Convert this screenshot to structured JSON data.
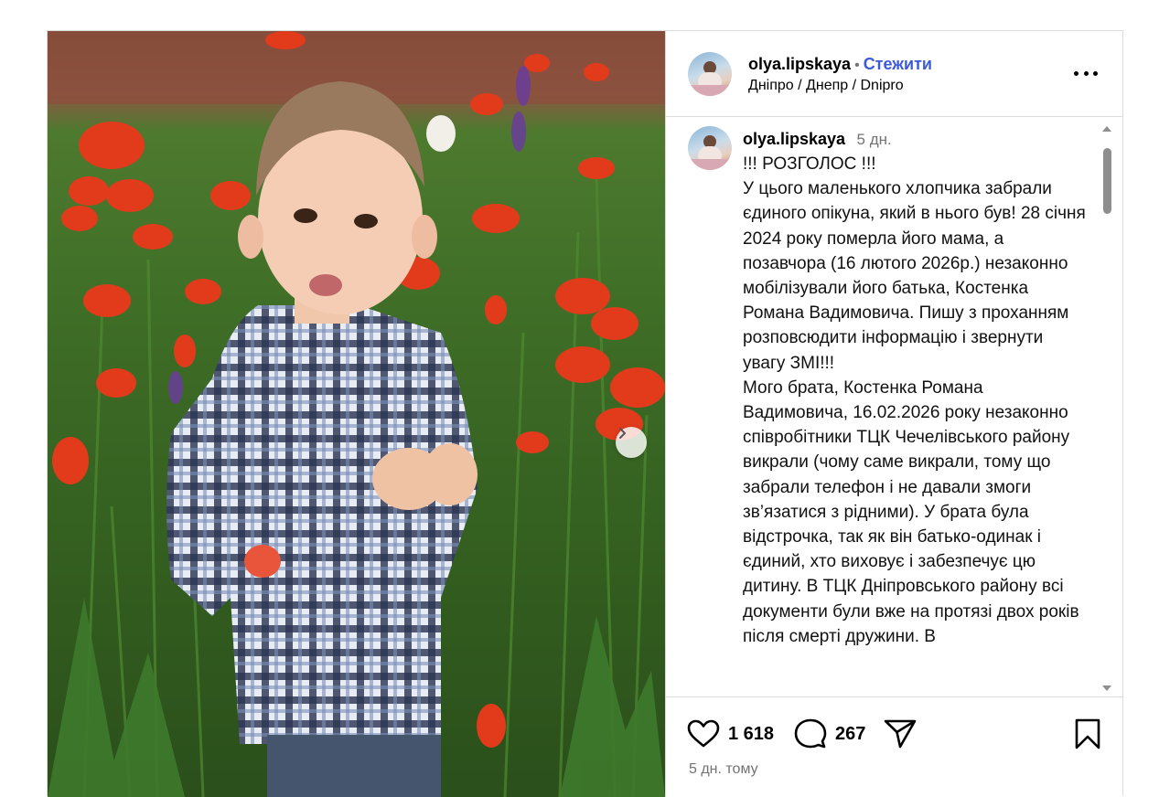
{
  "post": {
    "author": {
      "username": "olya.lipskaya",
      "separator": "•",
      "follow_label": "Стежити",
      "location": "Дніпро / Днепр / Dnipro"
    },
    "caption": {
      "username": "olya.lipskaya",
      "time": "5 дн.",
      "text": "!!! РОЗГОЛОС !!!\nУ цього маленького хлопчика забрали єдиного опікуна, який в нього був! 28 січня 2024 року померла його мама, а позавчора (16 лютого 2026р.) незаконно мобілізували його батька, Костенка Романа Вадимовича. Пишу з проханням розповсюдити інформацію і звернути увагу ЗМІ!!!\nМого брата, Костенка Романа Вадимовича, 16.02.2026 року незаконно співробітники ТЦК Чечелівського району викрали (чому саме викрали, тому що забрали телефон і не давали змоги зв’язатися з рідними). У брата була відстрочка, так як він батько-одинак і єдиний, хто виховує і забезпечує цю дитину. В ТЦК Дніпровського району всі документи були вже на протязі двох років після смерті дружини. В"
    },
    "likes": "1 618",
    "comments_count": "267",
    "posted_ago": "5 дн. тому",
    "icons": {
      "like": "heart-icon",
      "comment": "comment-icon",
      "share": "send-icon",
      "save": "bookmark-icon",
      "more": "more-icon",
      "next": "chevron-right-icon"
    },
    "colors": {
      "follow": "#3b5bdb",
      "muted": "#737373",
      "border": "#dbdbdb"
    }
  }
}
